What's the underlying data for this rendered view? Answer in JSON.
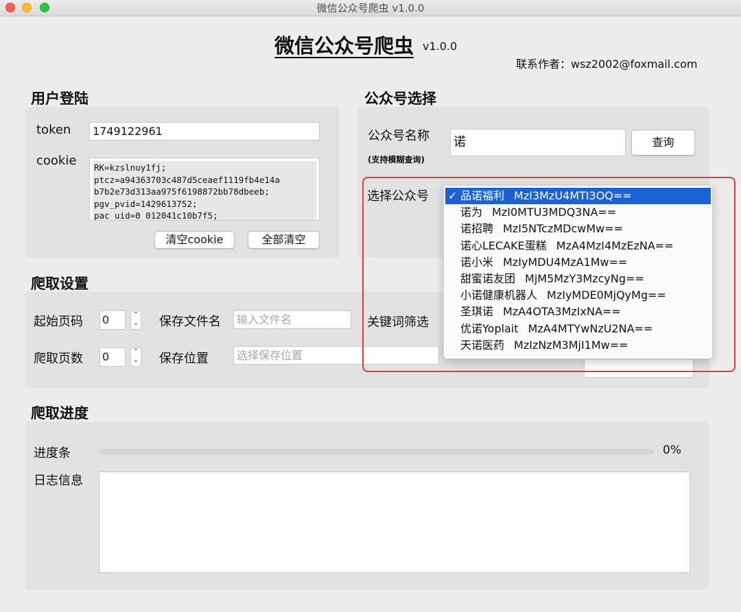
{
  "window": {
    "title": "微信公众号爬虫 v1.0.0"
  },
  "header": {
    "app_title": "微信公众号爬虫",
    "version": "v1.0.0",
    "contact": "联系作者：wsz2002@foxmail.com"
  },
  "login": {
    "section_title": "用户登陆",
    "token_label": "token",
    "token_value": "1749122961",
    "cookie_label": "cookie",
    "cookie_value": "RK=kzslnuy1fj;\nptcz=a94363703c487d5ceaef1119fb4e14a\nb7b2e73d313aa975f6198872bb78dbeeb;\npgv_pvid=1429613752;\npac_uid=0_012041c10b7f5;",
    "clear_cookie_button": "清空cookie",
    "clear_all_button": "全部清空"
  },
  "account": {
    "section_title": "公众号选择",
    "name_label": "公众号名称",
    "fuzzy_hint": "(支持模糊查询)",
    "name_value": "诺",
    "query_button": "查询",
    "select_label": "选择公众号",
    "options": [
      {
        "name": "品诺福利",
        "id": "MzI3MzU4MTI3OQ==",
        "selected": true
      },
      {
        "name": "诺为",
        "id": "MzI0MTU3MDQ3NA==",
        "selected": false
      },
      {
        "name": "诺招聘",
        "id": "MzI5NTczMDcwMw==",
        "selected": false
      },
      {
        "name": "诺心LECAKE蛋糕",
        "id": "MzA4MzI4MzEzNA==",
        "selected": false
      },
      {
        "name": "诺小米",
        "id": "MzIyMDU4MzA1Mw==",
        "selected": false
      },
      {
        "name": "甜蜜诺友团",
        "id": "MjM5MzY3MzcyNg==",
        "selected": false
      },
      {
        "name": "小诺健康机器人",
        "id": "MzIyMDE0MjQyMg==",
        "selected": false
      },
      {
        "name": "圣琪诺",
        "id": "MzA4OTA3MzIxNA==",
        "selected": false
      },
      {
        "name": "优诺Yoplait",
        "id": "MzA4MTYwNzU2NA==",
        "selected": false
      },
      {
        "name": "天诺医药",
        "id": "MzIzNzM3MjI1Mw==",
        "selected": false
      }
    ],
    "check_mark": "✓"
  },
  "crawl_settings": {
    "section_title": "爬取设置",
    "start_page_label": "起始页码",
    "start_page_value": "0",
    "page_count_label": "爬取页数",
    "page_count_value": "0",
    "filename_label": "保存文件名",
    "filename_placeholder": "输入文件名",
    "location_label": "保存位置",
    "location_placeholder": "选择保存位置",
    "keyword_label": "关键词筛选"
  },
  "progress": {
    "section_title": "爬取进度",
    "bar_label": "进度条",
    "percent_text": "0%",
    "percent_value": 0,
    "log_label": "日志信息",
    "log_text": ""
  },
  "colors": {
    "window_bg": "#ececec",
    "panel_bg": "#e2e2e2",
    "selection_blue": "#1b62d6",
    "highlight_red": "#e8372e"
  }
}
